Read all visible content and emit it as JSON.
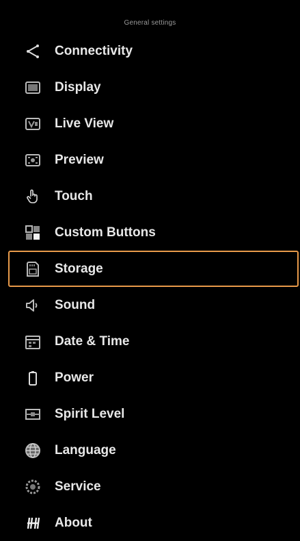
{
  "header": {
    "title": "General settings"
  },
  "accent_color": "#e89a4a",
  "menu": {
    "selected_index": 6,
    "items": [
      {
        "label": "Connectivity",
        "icon": "share-icon"
      },
      {
        "label": "Display",
        "icon": "display-icon"
      },
      {
        "label": "Live View",
        "icon": "live-view-icon"
      },
      {
        "label": "Preview",
        "icon": "preview-icon"
      },
      {
        "label": "Touch",
        "icon": "touch-icon"
      },
      {
        "label": "Custom Buttons",
        "icon": "custom-buttons-icon"
      },
      {
        "label": "Storage",
        "icon": "storage-icon"
      },
      {
        "label": "Sound",
        "icon": "speaker-icon"
      },
      {
        "label": "Date & Time",
        "icon": "calendar-icon"
      },
      {
        "label": "Power",
        "icon": "battery-icon"
      },
      {
        "label": "Spirit Level",
        "icon": "spirit-level-icon"
      },
      {
        "label": "Language",
        "icon": "globe-icon"
      },
      {
        "label": "Service",
        "icon": "service-icon"
      },
      {
        "label": "About",
        "icon": "about-icon"
      }
    ]
  }
}
